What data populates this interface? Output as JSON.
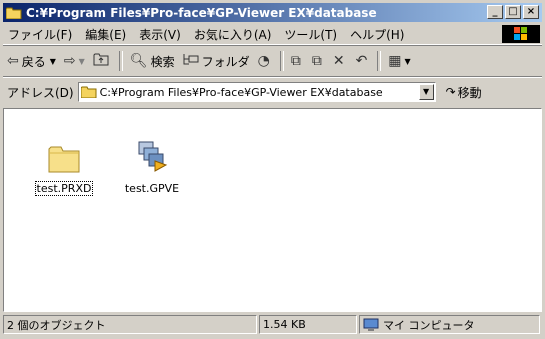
{
  "window": {
    "title": "C:¥Program Files¥Pro-face¥GP-Viewer EX¥database",
    "min_label": "_",
    "max_label": "□",
    "close_label": "×"
  },
  "menu": {
    "items": [
      "ファイル(F)",
      "編集(E)",
      "表示(V)",
      "お気に入り(A)",
      "ツール(T)",
      "ヘルプ(H)"
    ]
  },
  "toolbar": {
    "back_label": "戻る",
    "search_label": "検索",
    "folders_label": "フォルダ"
  },
  "address": {
    "label": "アドレス(D)",
    "value": "C:¥Program Files¥Pro-face¥GP-Viewer EX¥database",
    "go_label": "移動"
  },
  "files": [
    {
      "name": "test.PRXD",
      "icon": "folder-icon"
    },
    {
      "name": "test.GPVE",
      "icon": "gpve-file-icon"
    }
  ],
  "status": {
    "objects": "2 個のオブジェクト",
    "size": "1.54 KB",
    "location": "マイ コンピュータ"
  },
  "colors": {
    "title_start": "#0a246a",
    "title_end": "#a6caf0",
    "chrome": "#d4d0c8"
  }
}
